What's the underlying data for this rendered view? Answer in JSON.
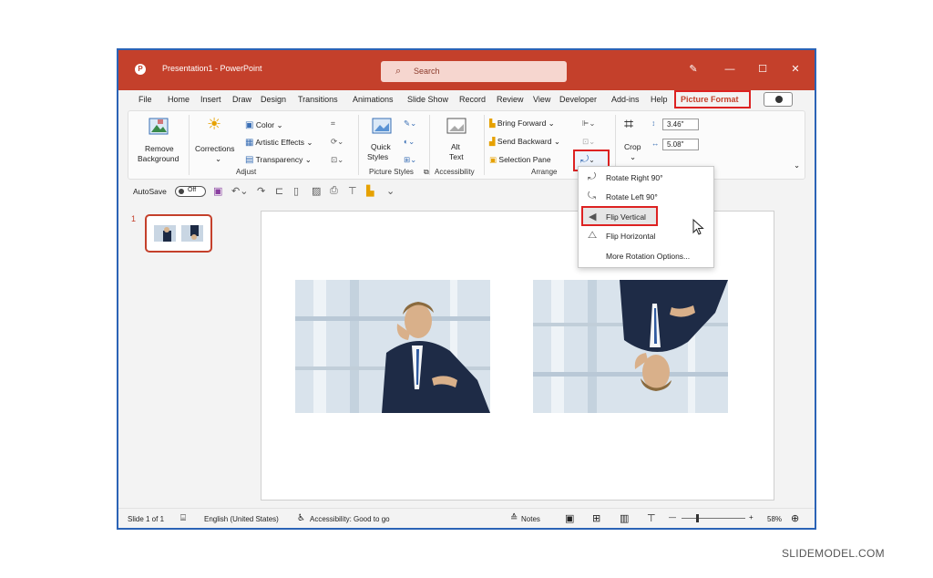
{
  "app": {
    "title": "Presentation1 - PowerPoint",
    "logo": "P"
  },
  "search": {
    "icon": "search-icon",
    "label": "Search"
  },
  "window": {
    "minimize": "—",
    "maximize": "☐",
    "close": "✕",
    "pen_icon": "✎"
  },
  "menu": {
    "items": [
      "File",
      "Home",
      "Insert",
      "Draw",
      "Design",
      "Transitions",
      "Animations",
      "Slide Show",
      "Record",
      "Review",
      "View",
      "Developer",
      "Add-ins",
      "Help",
      "Picture Format"
    ],
    "active": "Picture Format"
  },
  "ribbon": {
    "remove_bg": [
      "Remove",
      "Background"
    ],
    "corrections": "Corrections",
    "color": "Color",
    "artistic": "Artistic Effects",
    "transparency": "Transparency",
    "adjust_label": "Adjust",
    "quick_styles": [
      "Quick",
      "Styles"
    ],
    "picture_styles_label": "Picture Styles",
    "alt_text": [
      "Alt",
      "Text"
    ],
    "accessibility_label": "Accessibility",
    "bring_forward": "Bring Forward",
    "send_backward": "Send Backward",
    "selection_pane": "Selection Pane",
    "arrange_label": "Arrange",
    "crop": "Crop",
    "height": "3.46\"",
    "width": "5.08\""
  },
  "qat": {
    "autosave": "AutoSave",
    "toggle": "Off"
  },
  "thumbnail": {
    "number": "1"
  },
  "rotate_menu": {
    "items": [
      "Rotate Right 90°",
      "Rotate Left 90°",
      "Flip Vertical",
      "Flip Horizontal",
      "More Rotation Options..."
    ],
    "highlighted": "Flip Vertical"
  },
  "status": {
    "slide": "Slide 1 of 1",
    "language": "English (United States)",
    "accessibility": "Accessibility: Good to go",
    "notes": "Notes",
    "zoom": "58%"
  },
  "watermark": "SLIDEMODEL.COM",
  "colors": {
    "titlebar": "#c4402b",
    "frame": "#2b63b6",
    "highlight": "#dd2222"
  }
}
